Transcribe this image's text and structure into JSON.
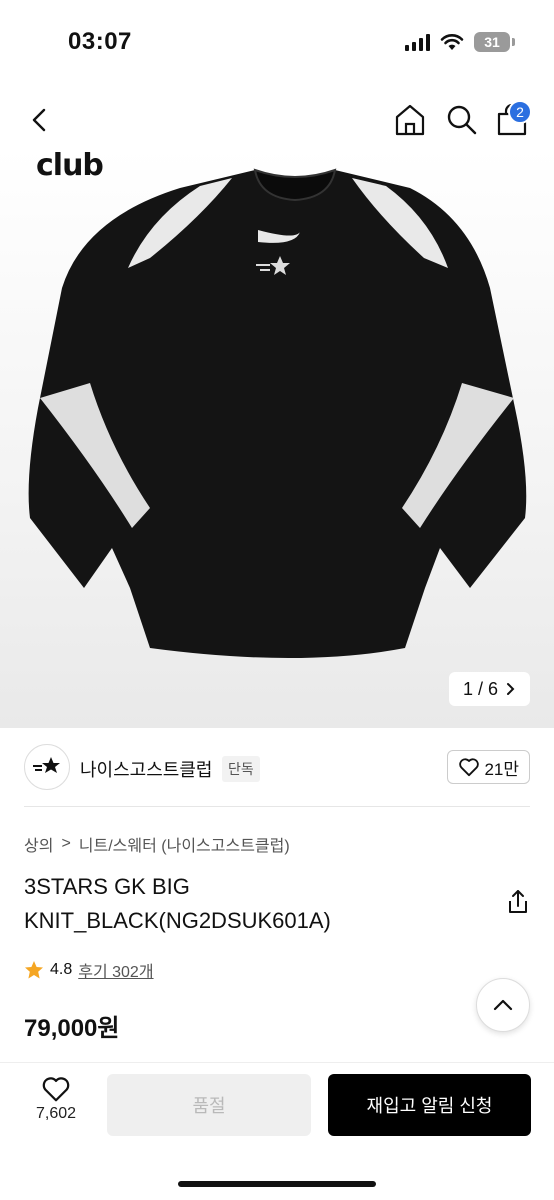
{
  "status_bar": {
    "time": "03:07",
    "battery": "31"
  },
  "nav": {
    "cart_count": "2"
  },
  "product_image": {
    "brand_text": "club",
    "counter": "1 / 6"
  },
  "brand": {
    "name": "나이스고스트클럽",
    "tag": "단독",
    "likes": "21만"
  },
  "breadcrumb": {
    "level1": "상의",
    "separator": ">",
    "level2": "니트/스웨터 (나이스고스트클럽)"
  },
  "product": {
    "title": "3STARS GK BIG KNIT_BLACK(NG2DSUK601A)",
    "rating": "4.8",
    "reviews": "후기 302개",
    "price": "79,000원"
  },
  "bottom_bar": {
    "wish_count": "7,602",
    "soldout_label": "품절",
    "restock_label": "재입고 알림 신청"
  },
  "colors": {
    "accent_blue": "#2b6fe0",
    "star": "#f5a623",
    "primary_button": "#000000",
    "disabled_button": "#efefef"
  }
}
